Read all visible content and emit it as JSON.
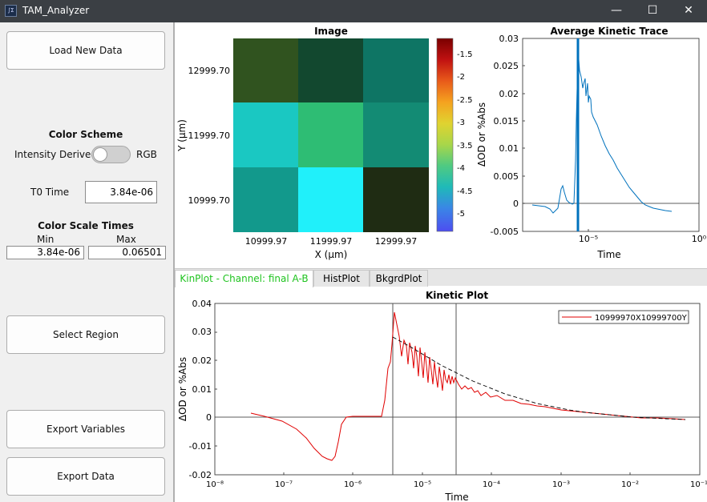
{
  "window": {
    "title": "TAM_Analyzer",
    "minimize": "—",
    "maximize": "☐",
    "close": "✕"
  },
  "sidebar": {
    "load_button": "Load New Data",
    "color_scheme": {
      "heading": "Color Scheme",
      "left_label": "Intensity Derived",
      "right_label": "RGB"
    },
    "t0": {
      "label": "T0 Time",
      "value": "3.84e-06"
    },
    "color_scale": {
      "heading": "Color Scale Times",
      "min_label": "Min",
      "max_label": "Max",
      "min_value": "3.84e-06",
      "max_value": "0.06501"
    },
    "select_region_button": "Select Region",
    "export_variables_button": "Export Variables",
    "export_data_button": "Export Data"
  },
  "image_panel": {
    "title": "Image",
    "xlabel": "X (μm)",
    "ylabel": "Y (μm)",
    "x_ticks": [
      "10999.97",
      "11999.97",
      "12999.97"
    ],
    "y_ticks": [
      "12999.70",
      "11999.70",
      "10999.70"
    ],
    "cells": [
      [
        "#30531f",
        "#12482f",
        "#0e7564"
      ],
      [
        "#1ac8c2",
        "#2ebd74",
        "#138b74"
      ],
      [
        "#12998c",
        "#20f0fa",
        "#1f2c13"
      ]
    ],
    "colorbar": {
      "ticks": [
        "-1.5",
        "-2",
        "-2.5",
        "-3",
        "-3.5",
        "-4",
        "-4.5",
        "-5"
      ],
      "label": "ΔOD or %Abs",
      "stops": [
        "#7a0000",
        "#c01111",
        "#e85a1a",
        "#f5a21f",
        "#e0d330",
        "#a8d64a",
        "#4fca82",
        "#1fbab8",
        "#3a86e6",
        "#4d4df0"
      ]
    }
  },
  "avg_trace": {
    "title": "Average Kinetic Trace",
    "xlabel": "Time",
    "ylabel": "ΔOD or %Abs",
    "y_ticks": [
      "0.03",
      "0.025",
      "0.02",
      "0.015",
      "0.01",
      "0.005",
      "0",
      "-0.005"
    ],
    "x_ticks": [
      "10⁻⁵",
      "10⁰"
    ],
    "line_color": "#0072bd"
  },
  "tabs": [
    {
      "label": "KinPlot - Channel: final A-B",
      "active": true
    },
    {
      "label": "HistPlot",
      "active": false
    },
    {
      "label": "BkgrdPlot",
      "active": false
    }
  ],
  "kinetic_plot": {
    "title": "Kinetic Plot",
    "xlabel": "Time",
    "ylabel": "ΔOD or %Abs",
    "legend": "10999970X10999700Y",
    "series_color": "#e00000",
    "y_ticks": [
      "0.04",
      "0.03",
      "0.02",
      "0.01",
      "0",
      "-0.01",
      "-0.02"
    ],
    "x_ticks": [
      "10⁻⁸",
      "10⁻⁷",
      "10⁻⁶",
      "10⁻⁵",
      "10⁻⁴",
      "10⁻³",
      "10⁻²",
      "10⁻¹"
    ]
  },
  "chart_data": [
    {
      "type": "line",
      "title": "Average Kinetic Trace",
      "xlabel": "Time",
      "ylabel": "ΔOD or %Abs",
      "x_scale": "log",
      "ylim": [
        -0.005,
        0.03
      ],
      "grid": false,
      "series": [
        {
          "values_approx": [
            [
              3.2e-07,
              -0.0004
            ],
            [
              5e-07,
              -0.0008
            ],
            [
              6.4e-07,
              -0.0016
            ],
            [
              8e-07,
              -0.0009
            ],
            [
              1.1e-06,
              -0.0008
            ],
            [
              1.4e-06,
              0.0022
            ],
            [
              1.55e-06,
              0.0037
            ],
            [
              1.8e-06,
              0.0012
            ],
            [
              2.5e-06,
              0.0008
            ],
            [
              3.2e-06,
              0.015
            ],
            [
              3.7e-06,
              0.0242
            ],
            [
              4e-06,
              0.0265
            ],
            [
              4.5e-06,
              0.0235
            ],
            [
              6e-06,
              0.0215
            ],
            [
              8e-06,
              0.019
            ],
            [
              1.2e-05,
              0.014
            ],
            [
              2e-05,
              0.01
            ],
            [
              4e-05,
              0.0055
            ],
            [
              0.0001,
              0.0005
            ],
            [
              0.0002,
              -0.0009
            ],
            [
              0.00035,
              -0.0014
            ]
          ]
        }
      ],
      "vertical_marker_x": 3.84e-06
    },
    {
      "type": "line",
      "title": "Kinetic Plot",
      "xlabel": "Time",
      "ylabel": "ΔOD or %Abs",
      "x_scale": "log",
      "xlim": [
        1e-08,
        0.1
      ],
      "ylim": [
        -0.02,
        0.04
      ],
      "legend": "top-right",
      "series": [
        {
          "name": "10999970X10999700Y",
          "values_approx": [
            [
              3.2e-08,
              0.0015
            ],
            [
              1e-07,
              -0.0015
            ],
            [
              2e-07,
              -0.0065
            ],
            [
              3.5e-07,
              -0.013
            ],
            [
              5e-07,
              -0.0155
            ],
            [
              6e-07,
              -0.0135
            ],
            [
              7.5e-07,
              -0.0005
            ],
            [
              1e-06,
              0.0001
            ],
            [
              2e-06,
              0.0003
            ],
            [
              2.8e-06,
              0.0002
            ],
            [
              3.3e-06,
              0.019
            ],
            [
              3.8e-06,
              0.024
            ],
            [
              4.3e-06,
              0.0365
            ],
            [
              5e-06,
              0.027
            ],
            [
              6e-06,
              0.031
            ],
            [
              7e-06,
              0.02
            ],
            [
              8e-06,
              0.026
            ],
            [
              1e-05,
              0.019
            ],
            [
              1.3e-05,
              0.024
            ],
            [
              1.6e-05,
              0.015
            ],
            [
              2e-05,
              0.021
            ],
            [
              3e-05,
              0.016
            ],
            [
              5e-05,
              0.012
            ],
            [
              0.0001,
              0.0085
            ],
            [
              0.0003,
              0.0048
            ],
            [
              0.001,
              0.0018
            ],
            [
              0.003,
              0.0005
            ],
            [
              0.01,
              -0.0003
            ],
            [
              0.06,
              -0.001
            ]
          ]
        },
        {
          "name": "fit (dashed)",
          "values_approx": [
            [
              4e-06,
              0.0285
            ],
            [
              1e-05,
              0.022
            ],
            [
              3e-05,
              0.0155
            ],
            [
              0.0001,
              0.0095
            ],
            [
              0.0003,
              0.005
            ],
            [
              0.001,
              0.002
            ],
            [
              0.01,
              -0.0002
            ],
            [
              0.06,
              -0.001
            ]
          ]
        }
      ],
      "vertical_markers_x": [
        3.84e-06,
        3.2e-05
      ]
    }
  ]
}
